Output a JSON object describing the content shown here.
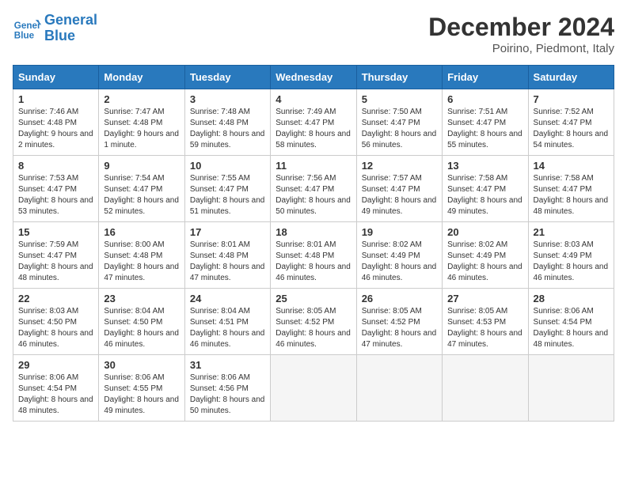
{
  "header": {
    "logo_line1": "General",
    "logo_line2": "Blue",
    "month_title": "December 2024",
    "location": "Poirino, Piedmont, Italy"
  },
  "days_of_week": [
    "Sunday",
    "Monday",
    "Tuesday",
    "Wednesday",
    "Thursday",
    "Friday",
    "Saturday"
  ],
  "weeks": [
    [
      {
        "day": "1",
        "sunrise": "7:46 AM",
        "sunset": "4:48 PM",
        "daylight": "9 hours and 2 minutes."
      },
      {
        "day": "2",
        "sunrise": "7:47 AM",
        "sunset": "4:48 PM",
        "daylight": "9 hours and 1 minute."
      },
      {
        "day": "3",
        "sunrise": "7:48 AM",
        "sunset": "4:48 PM",
        "daylight": "8 hours and 59 minutes."
      },
      {
        "day": "4",
        "sunrise": "7:49 AM",
        "sunset": "4:47 PM",
        "daylight": "8 hours and 58 minutes."
      },
      {
        "day": "5",
        "sunrise": "7:50 AM",
        "sunset": "4:47 PM",
        "daylight": "8 hours and 56 minutes."
      },
      {
        "day": "6",
        "sunrise": "7:51 AM",
        "sunset": "4:47 PM",
        "daylight": "8 hours and 55 minutes."
      },
      {
        "day": "7",
        "sunrise": "7:52 AM",
        "sunset": "4:47 PM",
        "daylight": "8 hours and 54 minutes."
      }
    ],
    [
      {
        "day": "8",
        "sunrise": "7:53 AM",
        "sunset": "4:47 PM",
        "daylight": "8 hours and 53 minutes."
      },
      {
        "day": "9",
        "sunrise": "7:54 AM",
        "sunset": "4:47 PM",
        "daylight": "8 hours and 52 minutes."
      },
      {
        "day": "10",
        "sunrise": "7:55 AM",
        "sunset": "4:47 PM",
        "daylight": "8 hours and 51 minutes."
      },
      {
        "day": "11",
        "sunrise": "7:56 AM",
        "sunset": "4:47 PM",
        "daylight": "8 hours and 50 minutes."
      },
      {
        "day": "12",
        "sunrise": "7:57 AM",
        "sunset": "4:47 PM",
        "daylight": "8 hours and 49 minutes."
      },
      {
        "day": "13",
        "sunrise": "7:58 AM",
        "sunset": "4:47 PM",
        "daylight": "8 hours and 49 minutes."
      },
      {
        "day": "14",
        "sunrise": "7:58 AM",
        "sunset": "4:47 PM",
        "daylight": "8 hours and 48 minutes."
      }
    ],
    [
      {
        "day": "15",
        "sunrise": "7:59 AM",
        "sunset": "4:47 PM",
        "daylight": "8 hours and 48 minutes."
      },
      {
        "day": "16",
        "sunrise": "8:00 AM",
        "sunset": "4:48 PM",
        "daylight": "8 hours and 47 minutes."
      },
      {
        "day": "17",
        "sunrise": "8:01 AM",
        "sunset": "4:48 PM",
        "daylight": "8 hours and 47 minutes."
      },
      {
        "day": "18",
        "sunrise": "8:01 AM",
        "sunset": "4:48 PM",
        "daylight": "8 hours and 46 minutes."
      },
      {
        "day": "19",
        "sunrise": "8:02 AM",
        "sunset": "4:49 PM",
        "daylight": "8 hours and 46 minutes."
      },
      {
        "day": "20",
        "sunrise": "8:02 AM",
        "sunset": "4:49 PM",
        "daylight": "8 hours and 46 minutes."
      },
      {
        "day": "21",
        "sunrise": "8:03 AM",
        "sunset": "4:49 PM",
        "daylight": "8 hours and 46 minutes."
      }
    ],
    [
      {
        "day": "22",
        "sunrise": "8:03 AM",
        "sunset": "4:50 PM",
        "daylight": "8 hours and 46 minutes."
      },
      {
        "day": "23",
        "sunrise": "8:04 AM",
        "sunset": "4:50 PM",
        "daylight": "8 hours and 46 minutes."
      },
      {
        "day": "24",
        "sunrise": "8:04 AM",
        "sunset": "4:51 PM",
        "daylight": "8 hours and 46 minutes."
      },
      {
        "day": "25",
        "sunrise": "8:05 AM",
        "sunset": "4:52 PM",
        "daylight": "8 hours and 46 minutes."
      },
      {
        "day": "26",
        "sunrise": "8:05 AM",
        "sunset": "4:52 PM",
        "daylight": "8 hours and 47 minutes."
      },
      {
        "day": "27",
        "sunrise": "8:05 AM",
        "sunset": "4:53 PM",
        "daylight": "8 hours and 47 minutes."
      },
      {
        "day": "28",
        "sunrise": "8:06 AM",
        "sunset": "4:54 PM",
        "daylight": "8 hours and 48 minutes."
      }
    ],
    [
      {
        "day": "29",
        "sunrise": "8:06 AM",
        "sunset": "4:54 PM",
        "daylight": "8 hours and 48 minutes."
      },
      {
        "day": "30",
        "sunrise": "8:06 AM",
        "sunset": "4:55 PM",
        "daylight": "8 hours and 49 minutes."
      },
      {
        "day": "31",
        "sunrise": "8:06 AM",
        "sunset": "4:56 PM",
        "daylight": "8 hours and 50 minutes."
      },
      null,
      null,
      null,
      null
    ]
  ]
}
